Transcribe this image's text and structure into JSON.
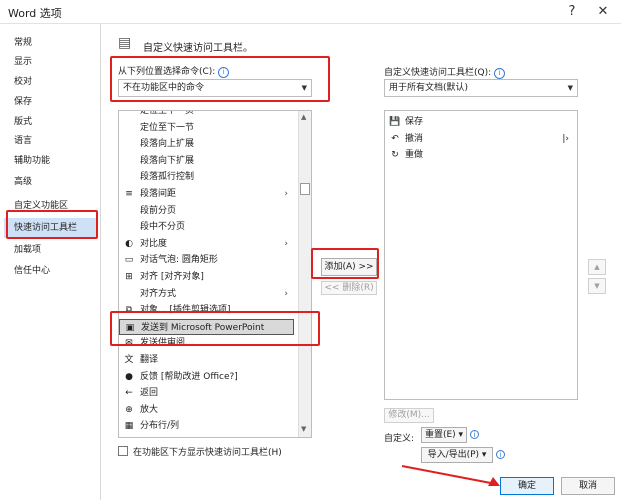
{
  "window": {
    "title": "Word 选项",
    "help_icon": "?",
    "close_icon": "✕"
  },
  "nav": {
    "items": [
      {
        "label": "常规"
      },
      {
        "label": "显示"
      },
      {
        "label": "校对"
      },
      {
        "label": "保存"
      },
      {
        "label": "版式"
      },
      {
        "label": "语言"
      },
      {
        "label": "辅助功能"
      },
      {
        "label": "高级"
      },
      {
        "label": "自定义功能区"
      },
      {
        "label": "快速访问工具栏"
      },
      {
        "label": "加载项"
      },
      {
        "label": "信任中心"
      }
    ],
    "active_index": 9
  },
  "header": {
    "title": "自定义快速访问工具栏。"
  },
  "choose": {
    "label": "从下列位置选择命令(C):",
    "value": "不在功能区中的命令",
    "items": [
      {
        "label": "定位至下一页",
        "icon": ""
      },
      {
        "label": "定位至下一节",
        "icon": ""
      },
      {
        "label": "段落向上扩展",
        "icon": ""
      },
      {
        "label": "段落向下扩展",
        "icon": ""
      },
      {
        "label": "段落孤行控制",
        "icon": ""
      },
      {
        "label": "段落间距",
        "icon": "≡",
        "submenu": "›"
      },
      {
        "label": "段前分页",
        "icon": ""
      },
      {
        "label": "段中不分页",
        "icon": ""
      },
      {
        "label": "对比度",
        "icon": "◐",
        "submenu": "›"
      },
      {
        "label": "对话气泡: 圆角矩形",
        "icon": "▭"
      },
      {
        "label": "对齐 [对齐对象]",
        "icon": "⊞"
      },
      {
        "label": "对齐方式",
        "icon": "",
        "submenu": "›"
      },
      {
        "label": "对象... [插件剪辑选项]",
        "icon": "⧉"
      },
      {
        "label": "发送到 Microsoft PowerPoint",
        "icon": "▣"
      },
      {
        "label": "发送供审阅...",
        "icon": "✉"
      },
      {
        "label": "翻译",
        "icon": "文"
      },
      {
        "label": "反馈 [帮助改进 Office?]",
        "icon": "●"
      },
      {
        "label": "返回",
        "icon": "←"
      },
      {
        "label": "放大",
        "icon": "⊕"
      },
      {
        "label": "分布行/列",
        "icon": "▦"
      }
    ]
  },
  "customize": {
    "label": "自定义快速访问工具栏(Q):",
    "value": "用于所有文档(默认)",
    "items": [
      {
        "label": "保存",
        "icon": "💾"
      },
      {
        "label": "撤消",
        "icon": "↶",
        "submenu": "|›"
      },
      {
        "label": "重做",
        "icon": "↻"
      }
    ]
  },
  "buttons": {
    "add": "添加(A) >>",
    "remove": "<< 删除(R)",
    "modify": "修改(M)...",
    "up": "▲",
    "down": "▼",
    "customize_label": "自定义:",
    "reset": "重置(E) ▾",
    "import_export": "导入/导出(P) ▾",
    "ok": "确定",
    "cancel": "取消"
  },
  "checkbox": {
    "label": "在功能区下方显示快速访问工具栏(H)"
  },
  "colors": {
    "highlight": "#cfe1f6",
    "annotation_red": "#e02020",
    "accent_blue": "#0078d7"
  }
}
